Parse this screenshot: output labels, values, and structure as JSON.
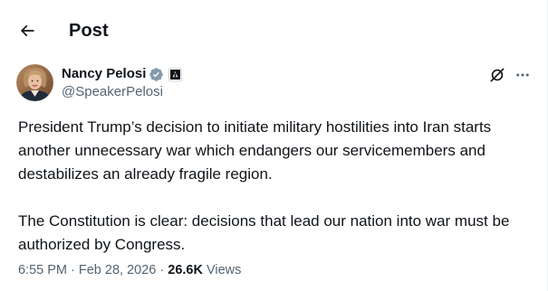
{
  "header": {
    "title": "Post"
  },
  "author": {
    "display_name": "Nancy Pelosi",
    "handle": "@SpeakerPelosi",
    "verified_color": "#829aab"
  },
  "tweet": {
    "paragraphs": [
      "President Trump’s decision to initiate military hostilities into Iran starts another unnecessary war which endangers our servicemembers and destabilizes an already fragile region.",
      "The Constitution is clear: decisions that lead our nation into war must be authorized by Congress."
    ]
  },
  "meta": {
    "time": "6:55 PM",
    "separator": " · ",
    "date": "Feb 28, 2026",
    "views_count": "26.6K",
    "views_label": "Views"
  },
  "icons": {
    "back": "arrow-left-icon",
    "verified": "verified-badge-icon",
    "affiliation": "government-affiliation-icon",
    "grok": "grok-icon",
    "more": "more-icon"
  }
}
